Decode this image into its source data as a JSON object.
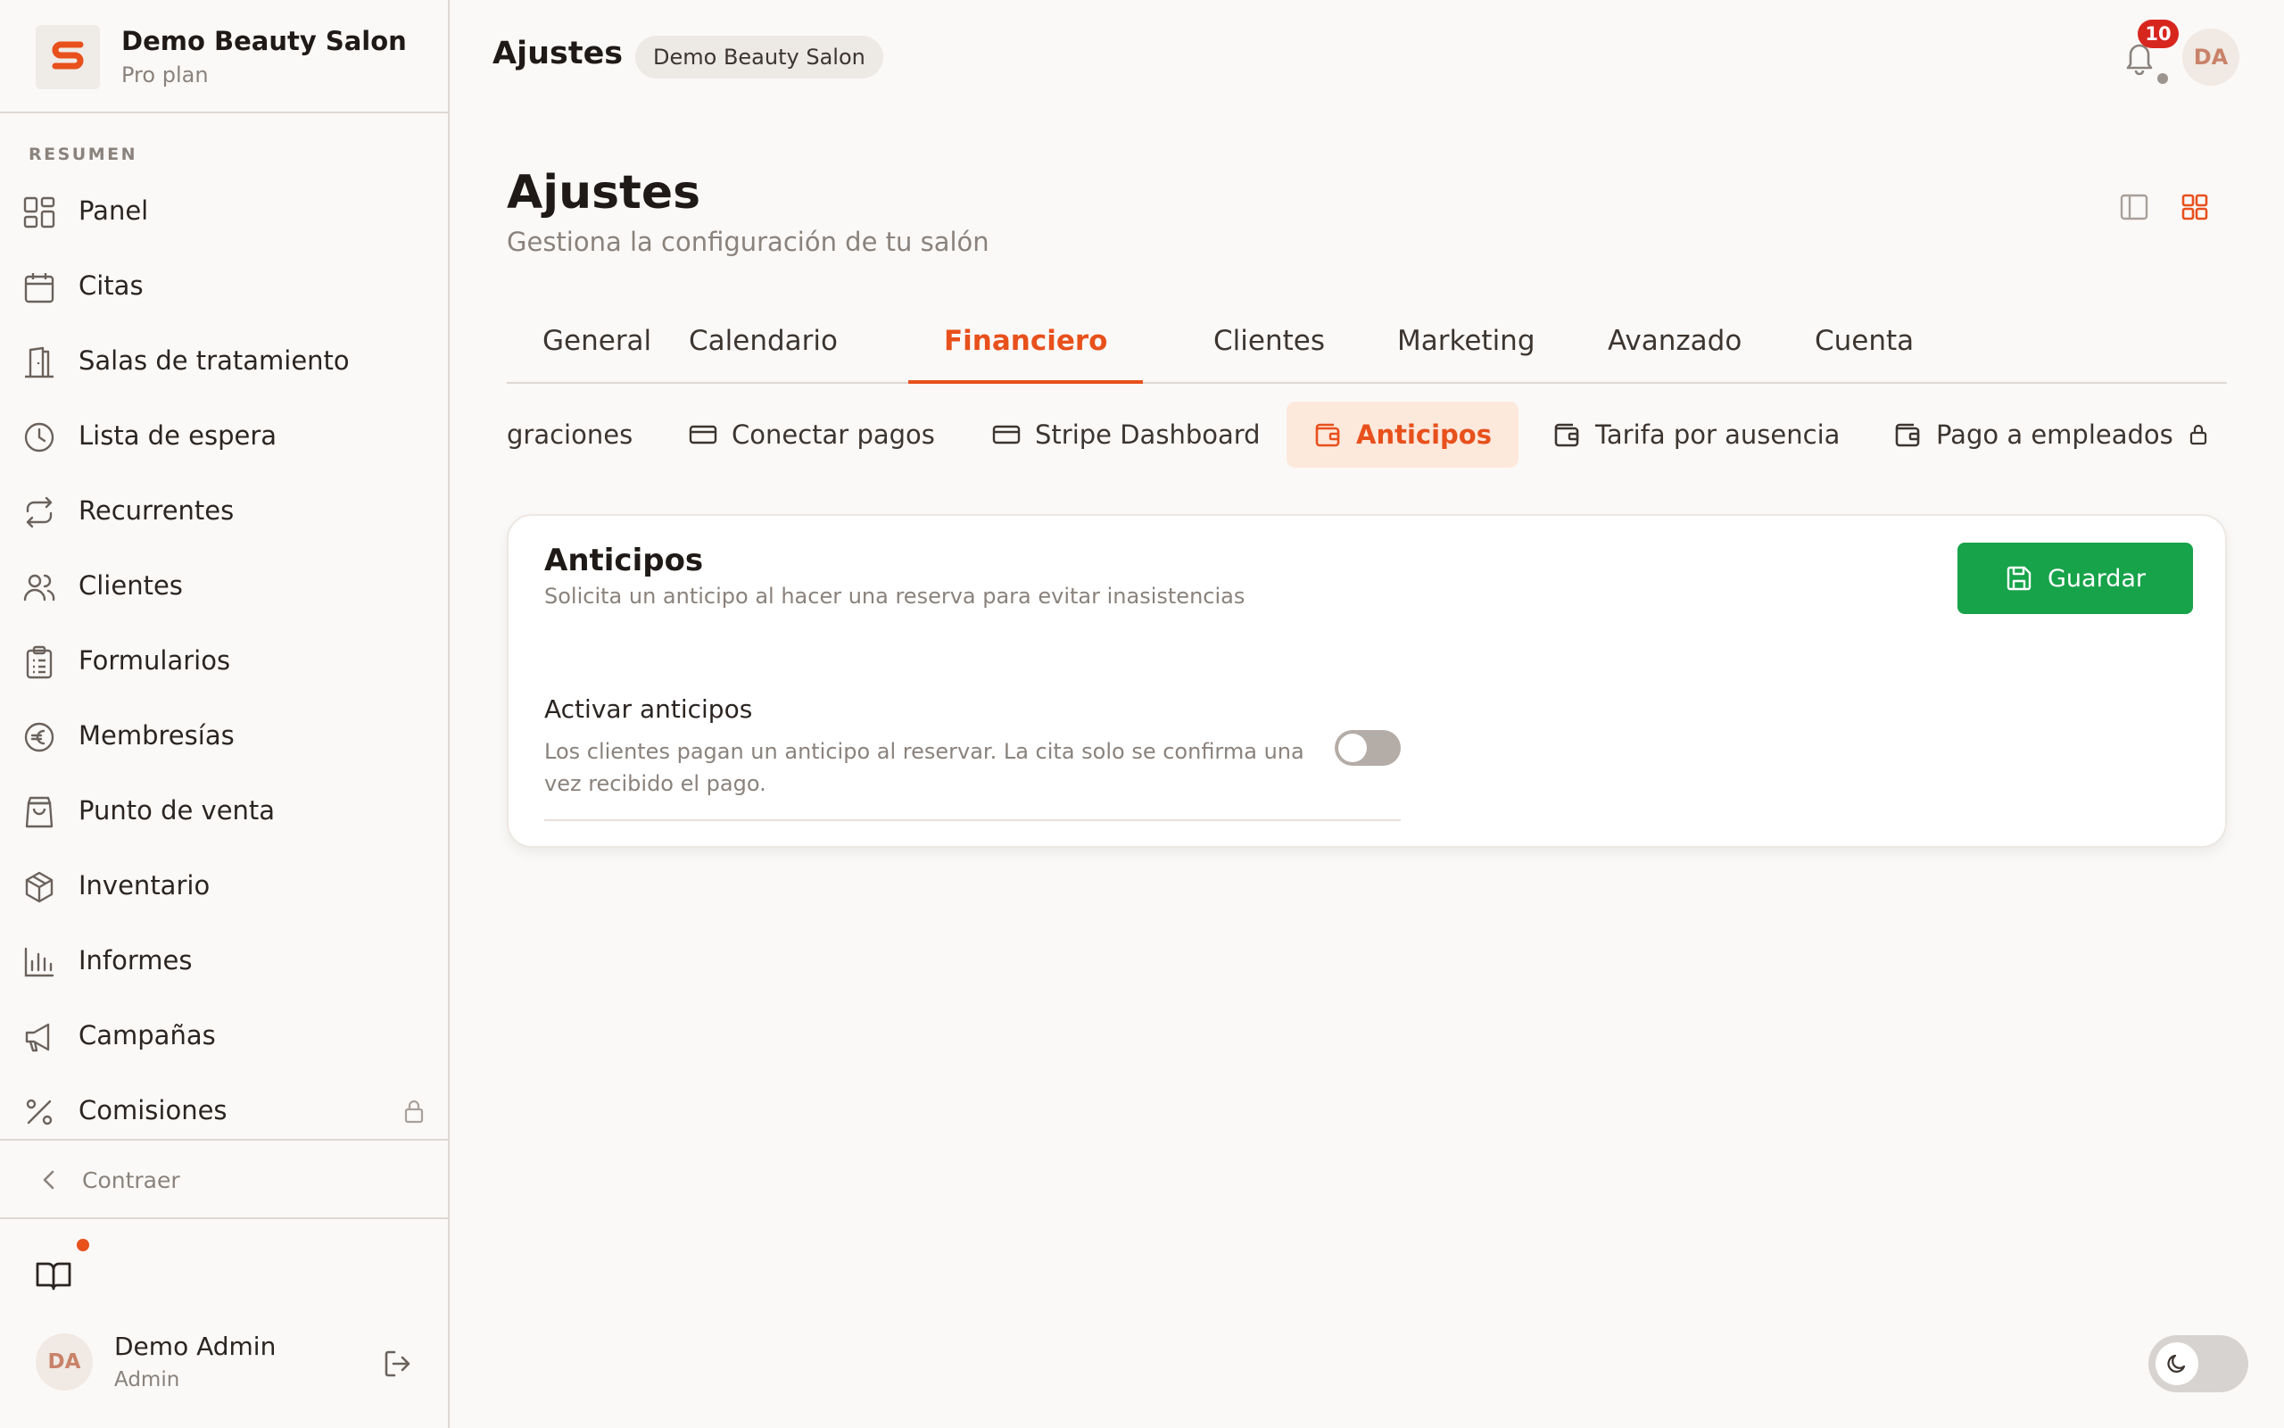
{
  "sidebar": {
    "brand_name": "Demo Beauty Salon",
    "brand_plan": "Pro plan",
    "section_label": "RESUMEN",
    "items": [
      {
        "label": "Panel",
        "icon": "grid-icon"
      },
      {
        "label": "Citas",
        "icon": "calendar-icon"
      },
      {
        "label": "Salas de tratamiento",
        "icon": "door-icon"
      },
      {
        "label": "Lista de espera",
        "icon": "clock-icon"
      },
      {
        "label": "Recurrentes",
        "icon": "repeat-icon"
      },
      {
        "label": "Clientes",
        "icon": "users-icon"
      },
      {
        "label": "Formularios",
        "icon": "clipboard-icon"
      },
      {
        "label": "Membresías",
        "icon": "euro-icon"
      },
      {
        "label": "Punto de venta",
        "icon": "shopping-bag-icon"
      },
      {
        "label": "Inventario",
        "icon": "package-icon"
      },
      {
        "label": "Informes",
        "icon": "bar-chart-icon"
      },
      {
        "label": "Campañas",
        "icon": "megaphone-icon"
      },
      {
        "label": "Comisiones",
        "icon": "percent-icon",
        "locked": true
      }
    ],
    "collapse_label": "Contraer",
    "user_initials": "DA",
    "user_name": "Demo Admin",
    "user_role": "Admin"
  },
  "topbar": {
    "title": "Ajustes",
    "chip": "Demo Beauty Salon",
    "notification_count": "10",
    "avatar_initials": "DA"
  },
  "page": {
    "title": "Ajustes",
    "subtitle": "Gestiona la configuración de tu salón"
  },
  "tabs": [
    {
      "label": "General"
    },
    {
      "label": "Calendario"
    },
    {
      "label": "Financiero",
      "active": true
    },
    {
      "label": "Clientes"
    },
    {
      "label": "Marketing"
    },
    {
      "label": "Avanzado"
    },
    {
      "label": "Cuenta"
    }
  ],
  "subtabs": [
    {
      "label": "graciones"
    },
    {
      "label": "Conectar pagos",
      "icon": "credit-card-icon"
    },
    {
      "label": "Stripe Dashboard",
      "icon": "credit-card-icon"
    },
    {
      "label": "Anticipos",
      "icon": "wallet-icon",
      "active": true
    },
    {
      "label": "Tarifa por ausencia",
      "icon": "wallet-icon"
    },
    {
      "label": "Pago a empleados",
      "icon": "wallet-icon",
      "locked": true
    }
  ],
  "card": {
    "title": "Anticipos",
    "description": "Solicita un anticipo al hacer una reserva para evitar inasistencias",
    "save_label": "Guardar",
    "setting_label": "Activar anticipos",
    "setting_help": "Los clientes pagan un anticipo al reservar. La cita solo se confirma una vez recibido el pago.",
    "setting_enabled": false
  },
  "colors": {
    "accent": "#e8501c",
    "success": "#17a34a",
    "badge": "#d7261e"
  }
}
